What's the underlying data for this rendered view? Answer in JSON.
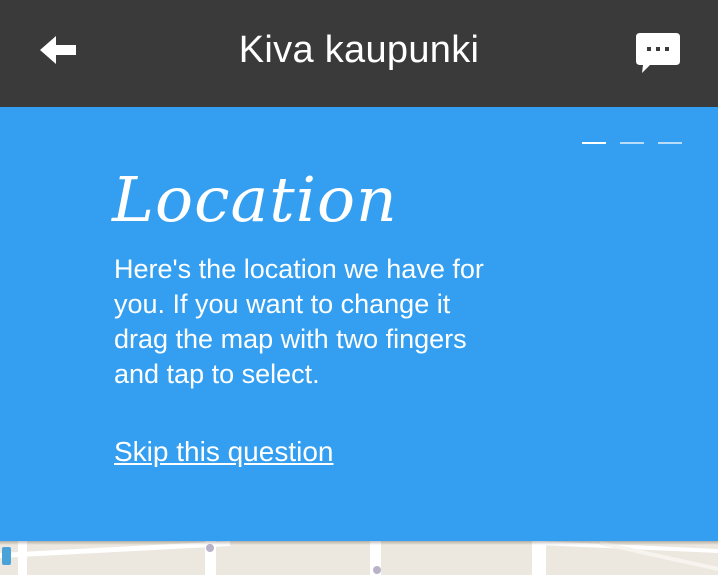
{
  "navbar": {
    "back_icon": "arrow-left-icon",
    "title": "Kiva kaupunki",
    "chat_icon": "chat-bubble-icon"
  },
  "panel": {
    "heading": "Location",
    "body": "Here's the location we have for you. If you want to change it drag the map with two fingers and tap to select.",
    "skip_label": "Skip this question",
    "pager_total": 3,
    "pager_active": 1,
    "background_color": "#349ff0"
  },
  "colors": {
    "navbar": "#3a3a3a",
    "panel": "#349ff0",
    "map_land": "#ede8df",
    "map_road": "#ffffff"
  }
}
